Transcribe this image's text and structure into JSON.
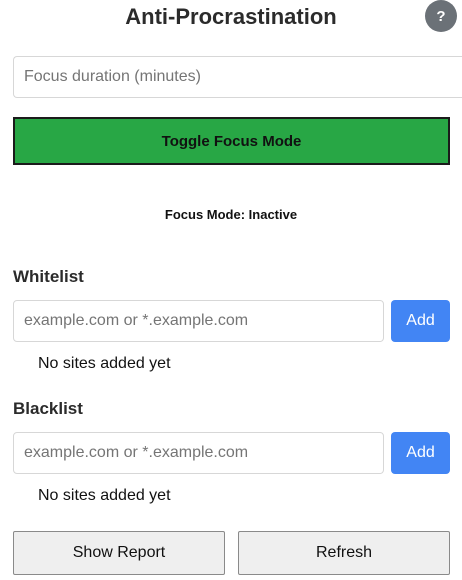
{
  "header": {
    "title": "Anti-Procrastination",
    "help_label": "?"
  },
  "focus": {
    "duration_placeholder": "Focus duration (minutes)",
    "duration_value": "",
    "toggle_label": "Toggle Focus Mode",
    "status_text": "Focus Mode: Inactive"
  },
  "whitelist": {
    "title": "Whitelist",
    "input_placeholder": "example.com or *.example.com",
    "add_label": "Add",
    "empty_text": "No sites added yet"
  },
  "blacklist": {
    "title": "Blacklist",
    "input_placeholder": "example.com or *.example.com",
    "add_label": "Add",
    "empty_text": "No sites added yet"
  },
  "footer": {
    "report_label": "Show Report",
    "refresh_label": "Refresh"
  },
  "colors": {
    "toggle_bg": "#28a745",
    "add_bg": "#4285f4",
    "help_bg": "#6b7177"
  }
}
